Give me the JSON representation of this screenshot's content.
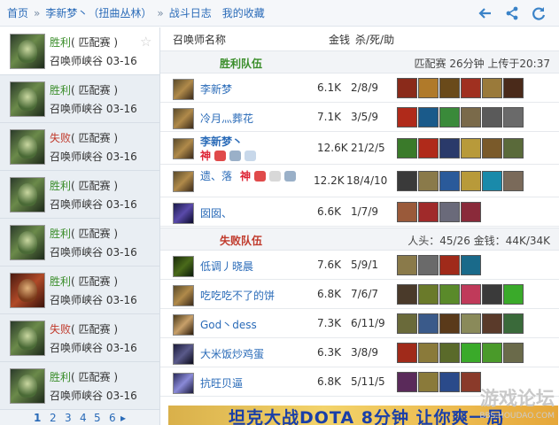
{
  "breadcrumb": {
    "home": "首页",
    "player": "李新梦丶（扭曲丛林）",
    "log": "战斗日志",
    "favorites": "我的收藏",
    "separator": "»"
  },
  "toolbar_icons": [
    "back-arrow-icon",
    "share-icon",
    "refresh-icon"
  ],
  "matches": [
    {
      "result": "胜利",
      "mode": "( 匹配赛 )",
      "map": "召唤师峡谷",
      "date": "03-16"
    },
    {
      "result": "胜利",
      "mode": "( 匹配赛 )",
      "map": "召唤师峡谷",
      "date": "03-16"
    },
    {
      "result": "失败",
      "mode": "( 匹配赛 )",
      "map": "召唤师峡谷",
      "date": "03-16"
    },
    {
      "result": "胜利",
      "mode": "( 匹配赛 )",
      "map": "召唤师峡谷",
      "date": "03-16"
    },
    {
      "result": "胜利",
      "mode": "( 匹配赛 )",
      "map": "召唤师峡谷",
      "date": "03-16"
    },
    {
      "result": "胜利",
      "mode": "( 匹配赛 )",
      "map": "召唤师峡谷",
      "date": "03-16"
    },
    {
      "result": "失败",
      "mode": "( 匹配赛 )",
      "map": "召唤师峡谷",
      "date": "03-16"
    },
    {
      "result": "胜利",
      "mode": "( 匹配赛 )",
      "map": "召唤师峡谷",
      "date": "03-16"
    }
  ],
  "pager": [
    "1",
    "2",
    "3",
    "4",
    "5",
    "6",
    "▸"
  ],
  "table_header": {
    "name": "召唤师名称",
    "money": "金钱",
    "kda": "杀/死/助"
  },
  "winning_team": {
    "label": "胜利队伍",
    "info": "匹配赛 26分钟 上传于20:37",
    "players": [
      {
        "name": "李新梦",
        "money": "6.1K",
        "kda": "2/8/9"
      },
      {
        "name": "冷月灬葬花",
        "money": "7.1K",
        "kda": "3/5/9"
      },
      {
        "name": "李新梦丶",
        "money": "12.6K",
        "kda": "21/2/5",
        "badge": "神"
      },
      {
        "name": "遗、落",
        "money": "12.2K",
        "kda": "18/4/10",
        "badge": "神"
      },
      {
        "name": "囡囡、",
        "money": "6.6K",
        "kda": "1/7/9"
      }
    ]
  },
  "losing_team": {
    "label": "失败队伍",
    "info": "人头：45/26 金钱：44K/34K",
    "players": [
      {
        "name": "低调丿晓晨",
        "money": "7.6K",
        "kda": "5/9/1"
      },
      {
        "name": "吃吃吃不了的饼",
        "money": "6.8K",
        "kda": "7/6/7"
      },
      {
        "name": "God丶dess",
        "money": "7.3K",
        "kda": "6/11/9"
      },
      {
        "name": "大米饭炒鸡蛋",
        "money": "6.3K",
        "kda": "3/8/9"
      },
      {
        "name": "抗旺贝逼",
        "money": "6.8K",
        "kda": "5/11/5"
      }
    ]
  },
  "ad_banner": {
    "text": "坦克大战DOTA 8分钟 让你爽一局"
  },
  "watermark": {
    "title": "游戏论坛",
    "site": "BBS.HOUDAO.COM"
  },
  "colors": {
    "win": "#3a8d2a",
    "lose": "#c0392b",
    "link": "#2a6bb8"
  }
}
